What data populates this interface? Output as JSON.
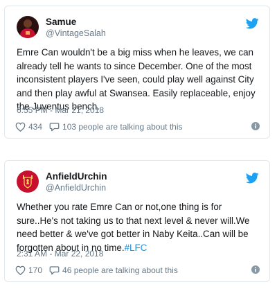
{
  "tweets": [
    {
      "name": "Samue",
      "handle": "@VintageSalah",
      "text": "Emre Can wouldn't be a big miss when he leaves, we can already tell he wants to since December. One of the most inconsistent players I've seen, could play well against City and then play awful at Swansea. Easily replaceable, enjoy the Juventus bench.",
      "timestamp": "6:55 PM - Mar 21, 2018",
      "likes": "434",
      "talking": "103 people are talking about this",
      "avatar_icon": "player-photo-icon"
    },
    {
      "name": "AnfieldUrchin",
      "handle": "@AnfieldUrchin",
      "text": "Whether you rate Emre Can or not,one thing is for sure..He's not taking us to that next level & never will.We need better & we've got better in Naby Keita..Can will be forgotten about in no time.",
      "hashtag": "#LFC",
      "timestamp": "2:31 AM - Mar 22, 2018",
      "likes": "170",
      "talking": "46 people are talking about this",
      "avatar_icon": "liverpool-crest-icon"
    }
  ],
  "colors": {
    "twitter_blue": "#1da1f2",
    "hashtag": "#1b95e0",
    "secondary_text": "#657786",
    "border": "#e1e8ed"
  }
}
